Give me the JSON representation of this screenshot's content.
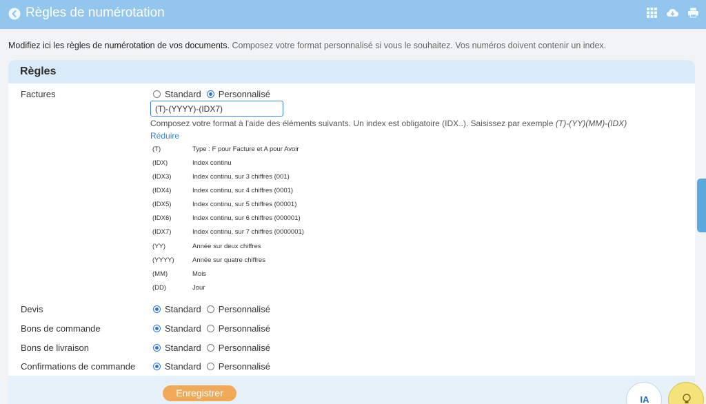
{
  "header": {
    "title": "Règles de numérotation",
    "icons": [
      "back-arrow-icon",
      "grid-icon",
      "cloud-download-icon",
      "print-icon"
    ]
  },
  "intro": {
    "strong": "Modifiez ici les règles de numérotation de vos documents.",
    "soft": " Composez votre format personnalisé si vous le souhaitez. Vos numéros doivent contenir un index."
  },
  "card": {
    "title": "Règles"
  },
  "options": {
    "standard": "Standard",
    "custom": "Personnalisé"
  },
  "rules": [
    {
      "label": "Factures",
      "selected": "custom"
    },
    {
      "label": "Devis",
      "selected": "standard"
    },
    {
      "label": "Bons de commande",
      "selected": "standard"
    },
    {
      "label": "Bons de livraison",
      "selected": "standard"
    },
    {
      "label": "Confirmations de commande",
      "selected": "standard"
    }
  ],
  "format": {
    "value": "(T)-(YYYY)-(IDX7)",
    "help": "Composez votre format à l'aide des éléments suivants. Un index est obligatoire (IDX..). Saisissez par exemple ",
    "example": "(T)-(YY)(MM)-(IDX)",
    "reduce": "Réduire"
  },
  "tokens": [
    {
      "code": "(T)",
      "desc": "Type : F pour Facture et A pour Avoir"
    },
    {
      "code": "(IDX)",
      "desc": "Index continu"
    },
    {
      "code": "(IDX3)",
      "desc": "Index continu, sur 3 chiffres (001)"
    },
    {
      "code": "(IDX4)",
      "desc": "Index continu, sur 4 chiffres (0001)"
    },
    {
      "code": "(IDX5)",
      "desc": "Index continu, sur 5 chiffres (00001)"
    },
    {
      "code": "(IDX6)",
      "desc": "Index continu, sur 6 chiffres (000001)"
    },
    {
      "code": "(IDX7)",
      "desc": "Index continu, sur 7 chiffres (0000001)"
    },
    {
      "code": "(YY)",
      "desc": "Année sur deux chiffres"
    },
    {
      "code": "(YYYY)",
      "desc": "Année sur quatre chiffres"
    },
    {
      "code": "(MM)",
      "desc": "Mois"
    },
    {
      "code": "(DD)",
      "desc": "Jour"
    }
  ],
  "actions": {
    "save": "Enregistrer",
    "ia": "IA"
  },
  "colors": {
    "header": "#93c6ec",
    "accent": "#f0a957",
    "link": "#3a83cf",
    "radio": "#2f74d8"
  }
}
